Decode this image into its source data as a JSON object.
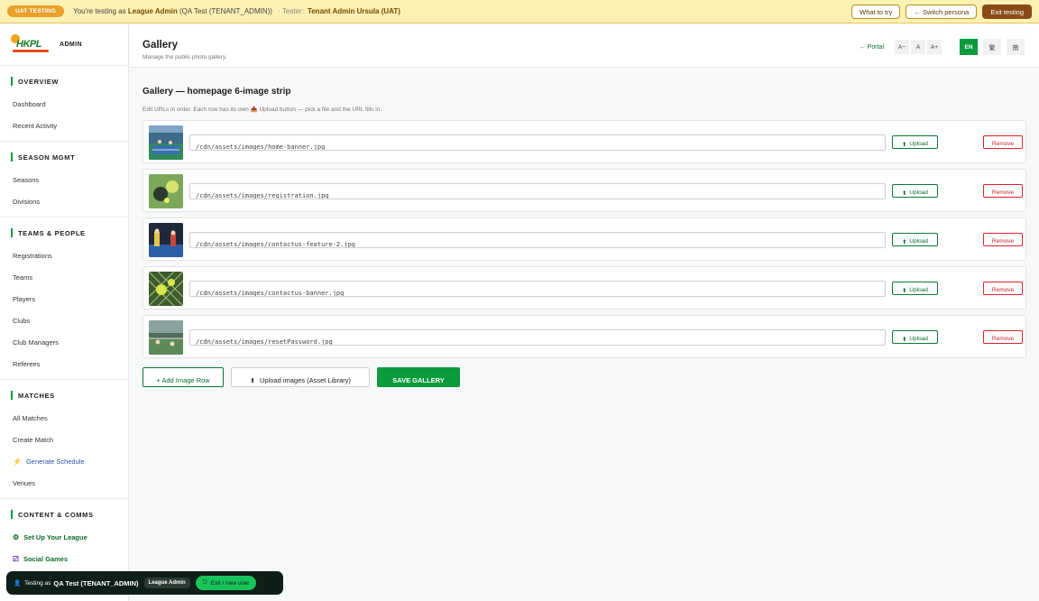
{
  "uat": {
    "pill": "UAT TESTING",
    "prefix": "You're testing as",
    "role": "League Admin",
    "context": "(QA Test (TENANT_ADMIN))",
    "tester_prefix": "· Tester:",
    "tester_name": "Tenant Admin Ursula (UAT)",
    "what_to_try": "What to try",
    "switch_persona": "← Switch persona",
    "exit_testing": "Exit testing"
  },
  "brand": {
    "logo_text": "HKPL",
    "label": "ADMIN"
  },
  "sidebar": {
    "groups": [
      {
        "title": "OVERVIEW",
        "items": [
          "Dashboard",
          "Recent Activity"
        ]
      },
      {
        "title": "SEASON MGMT",
        "items": [
          "Seasons",
          "Divisions"
        ]
      },
      {
        "title": "TEAMS & PEOPLE",
        "items": [
          "Registrations",
          "Teams",
          "Players",
          "Clubs",
          "Club Managers",
          "Referees"
        ]
      },
      {
        "title": "MATCHES",
        "items": [
          "All Matches",
          "Create Match",
          "Generate Schedule",
          "Venues"
        ]
      },
      {
        "title": "CONTENT & COMMS",
        "items": [
          "Set Up Your League",
          "Social Games"
        ]
      }
    ]
  },
  "header": {
    "title": "Gallery",
    "subtitle": "Manage the public photo gallery.",
    "portal": "← Portal",
    "font_sizes": [
      "A−",
      "A",
      "A+"
    ],
    "languages": [
      "EN",
      "繁",
      "簡"
    ]
  },
  "gallery": {
    "title": "Gallery — homepage 6-image strip",
    "help": "Edit URLs in order. Each row has its own 📤 Upload button — pick a file and the URL fills in.",
    "upload_label": "Upload",
    "remove_label": "Remove",
    "rows": [
      {
        "url": "/cdn/assets/images/home-banner.jpg"
      },
      {
        "url": "/cdn/assets/images/registration.jpg"
      },
      {
        "url": "/cdn/assets/images/contactus-feature-2.jpg"
      },
      {
        "url": "/cdn/assets/images/contactus-banner.jpg"
      },
      {
        "url": "/cdn/assets/images/resetPassword.jpg"
      }
    ],
    "add_row": "+ Add Image Row",
    "upload_library": "Upload images (Asset Library)",
    "save": "SAVE GALLERY"
  },
  "tester_pill": {
    "prefix": "Testing as",
    "name": "QA Test (TENANT_ADMIN)",
    "role": "League Admin",
    "exit": "Exit / new user"
  },
  "colors": {
    "accent": "#0b9a3c",
    "danger": "#d9232a",
    "banner": "#fdf0b3"
  }
}
